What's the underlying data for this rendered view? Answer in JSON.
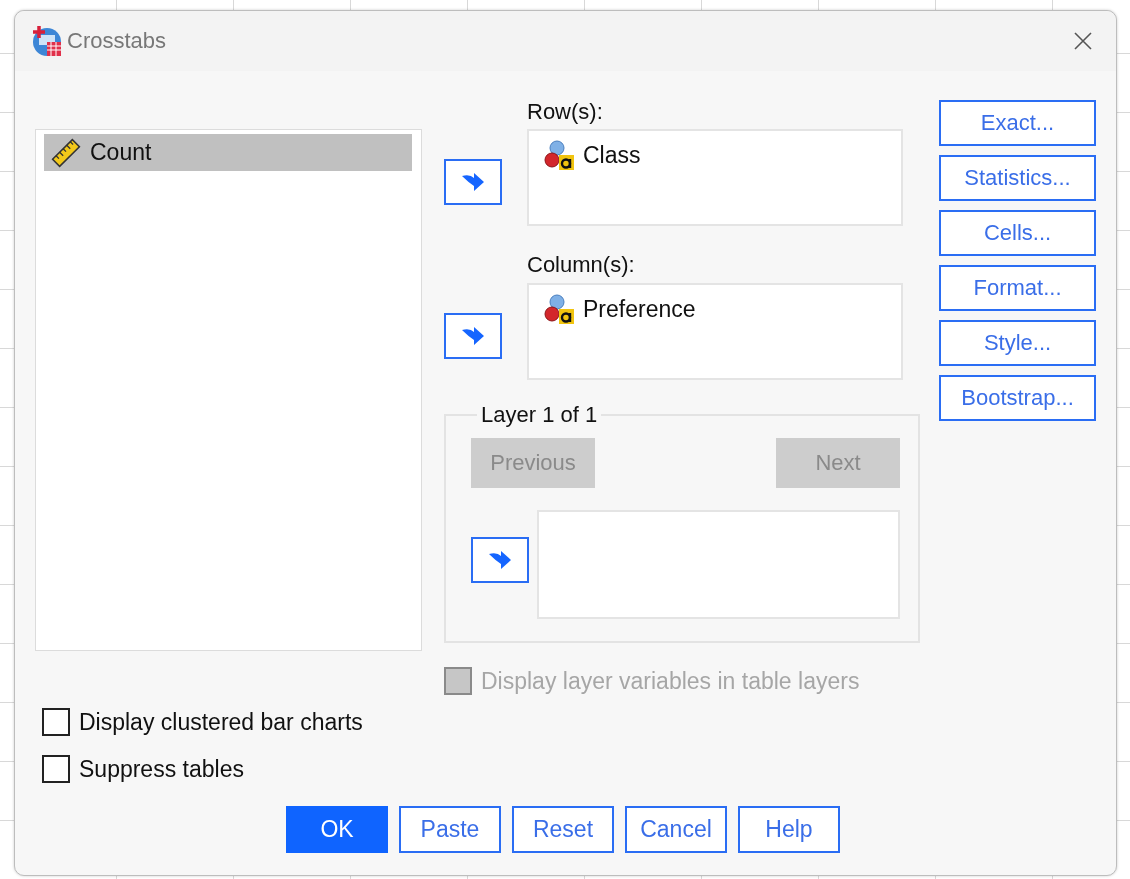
{
  "window": {
    "title": "Crosstabs"
  },
  "source_list": {
    "items": [
      {
        "label": "Count",
        "kind": "scale",
        "selected": true
      }
    ]
  },
  "rows": {
    "label": "Row(s):",
    "items": [
      {
        "label": "Class",
        "kind": "nominal"
      }
    ]
  },
  "columns": {
    "label": "Column(s):",
    "items": [
      {
        "label": "Preference",
        "kind": "nominal"
      }
    ]
  },
  "layer": {
    "title": "Layer 1 of 1",
    "previous": {
      "label": "Previous",
      "disabled": true
    },
    "next": {
      "label": "Next",
      "disabled": true
    }
  },
  "layer_option": {
    "label": "Display layer variables in table layers",
    "checked": false,
    "disabled": true
  },
  "side_buttons": [
    "Exact...",
    "Statistics...",
    "Cells...",
    "Format...",
    "Style...",
    "Bootstrap..."
  ],
  "options": [
    {
      "label": "Display clustered bar charts",
      "checked": false
    },
    {
      "label": "Suppress tables",
      "checked": false
    }
  ],
  "buttons": [
    {
      "label": "OK",
      "default": true
    },
    {
      "label": "Paste",
      "default": false
    },
    {
      "label": "Reset",
      "default": false
    },
    {
      "label": "Cancel",
      "default": false
    },
    {
      "label": "Help",
      "default": false
    }
  ]
}
